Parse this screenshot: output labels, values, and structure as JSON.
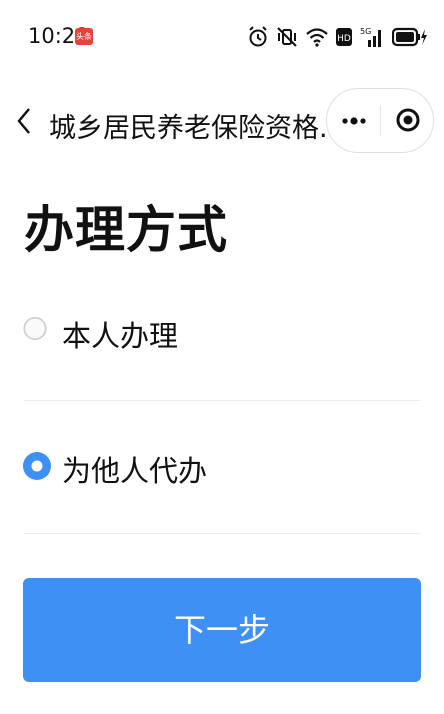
{
  "status_bar": {
    "time": "10:28",
    "badge_text": "头条",
    "icons": [
      "alarm-icon",
      "vibrate-mute-icon",
      "wifi-icon",
      "hd-icon",
      "signal-5g-icon",
      "battery-charging-icon"
    ],
    "network_label": "5G",
    "hd_label": "HD"
  },
  "nav": {
    "title": "城乡居民养老保险资格...",
    "icons": [
      "back-icon",
      "more-icon",
      "target-icon"
    ]
  },
  "page": {
    "title": "办理方式"
  },
  "options": [
    {
      "label": "本人办理",
      "selected": false
    },
    {
      "label": "为他人代办",
      "selected": true
    }
  ],
  "next_button": {
    "label": "下一步"
  },
  "colors": {
    "accent": "#3f90f4",
    "radio_selected": "#3f90f4",
    "radio_unselected_border": "#cfcfcf",
    "badge": "#e8413a"
  }
}
